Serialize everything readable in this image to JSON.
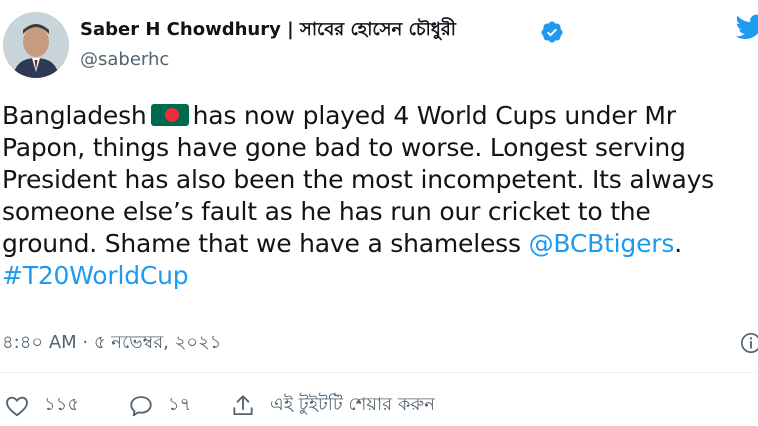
{
  "author": {
    "display_name": "Saber H Chowdhury | সাবের হোসেন চৌধুরী",
    "handle": "@saberhc",
    "verified": true,
    "avatar_icon": "profile-photo"
  },
  "tweet": {
    "lines": [
      {
        "before": "Bangladesh",
        "flag": "flag-bangladesh",
        "after": "has now played 4 World Cups under Mr"
      },
      {
        "text": "Papon, things have gone bad to worse. Longest serving"
      },
      {
        "text": "President has also been the most incompetent. Its always"
      },
      {
        "text": "someone else’s fault as he has run our cricket to the"
      },
      {
        "before": "ground. Shame that we have a shameless ",
        "mention": "@BCBtigers",
        "after": "."
      },
      {
        "hashtag": "#T20WorldCup"
      }
    ]
  },
  "meta": {
    "timestamp": "৪:৪০ AM · ৫ নভেম্বর, ২০২১"
  },
  "actions": {
    "like_count": "১১৫",
    "reply_count": "১৭",
    "share_label": "এই টুইটটি শেয়ার করুন"
  },
  "colors": {
    "link": "#1d9bf0",
    "text": "#0f1419",
    "secondary": "#536471",
    "divider": "#eff3f4"
  }
}
